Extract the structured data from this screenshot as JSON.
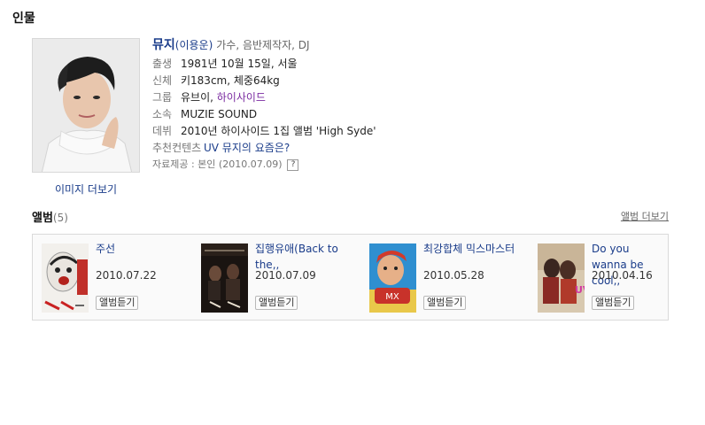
{
  "section_title": "인물",
  "profile": {
    "name": "뮤지",
    "alias": "(이용운)",
    "roles": "가수, 음반제작자, DJ",
    "more_images": "이미지 더보기",
    "rows": [
      {
        "label": "출생",
        "value": "1981년 10월 15일, 서울"
      },
      {
        "label": "신체",
        "value": "키183cm, 체중64kg"
      },
      {
        "label": "소속",
        "value": "MUZIE SOUND"
      },
      {
        "label": "데뷔",
        "value": "2010년 하이사이드 1집 앨범 'High Syde'"
      }
    ],
    "group_label": "그룹",
    "group_a": "유브이",
    "group_sep": ", ",
    "group_b": "하이사이드",
    "rec_label": "추천컨텐츠",
    "rec_value": "UV 뮤지의 요즘은?",
    "source": "자료제공 : 본인 (2010.07.09)",
    "help_icon": "?"
  },
  "albums_section": {
    "title": "앨범",
    "count": "(5)",
    "more": "앨범 더보기",
    "listen_label": "앨범듣기",
    "items": [
      {
        "title": "주선",
        "date": "2010.07.22"
      },
      {
        "title": "집행유애(Back to the,,",
        "date": "2010.07.09"
      },
      {
        "title": "최강합체 믹스마스터",
        "date": "2010.05.28"
      },
      {
        "title": "Do you wanna be cool,,",
        "date": "2010.04.16"
      }
    ]
  }
}
